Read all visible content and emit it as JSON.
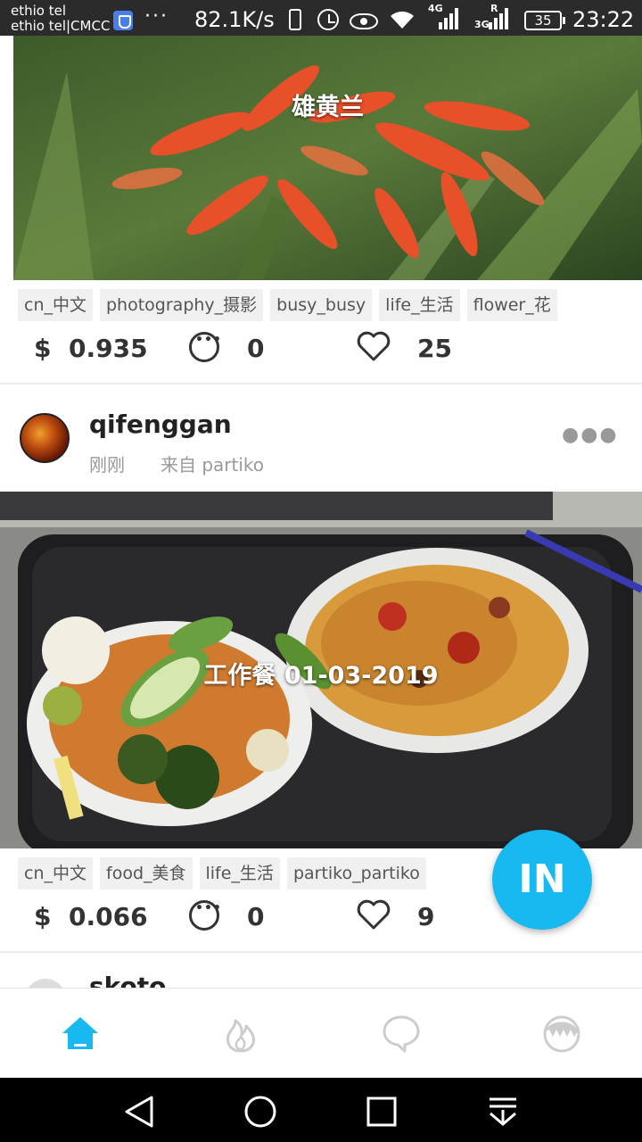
{
  "status_bar": {
    "carrier_1": "ethio tel",
    "carrier_2": "ethio tel|CMCC",
    "dots": "···",
    "net_speed": "82.1K/s",
    "network_1": "4G",
    "network_2": "R",
    "network_3": "3G",
    "battery": "35",
    "time": "23:22"
  },
  "posts": [
    {
      "image_caption": "雄黄兰",
      "tags": [
        "cn_中文",
        "photography_摄影",
        "busy_busy",
        "life_生活",
        "flower_花"
      ],
      "currency": "$",
      "payout": "0.935",
      "comments": "0",
      "likes": "25"
    },
    {
      "author": "qifenggan",
      "time": "刚刚",
      "source": "来自  partiko",
      "image_caption": "工作餐 01-03-2019",
      "tags": [
        "cn_中文",
        "food_美食",
        "life_生活",
        "partiko_partiko"
      ],
      "currency": "$",
      "payout": "0.066",
      "comments": "0",
      "likes": "9"
    }
  ],
  "next_post_author_peek": "skoto",
  "fab_label": "IN",
  "bottom_nav": {
    "items": [
      "home-icon",
      "fire-icon",
      "chat-icon",
      "profile-icon"
    ],
    "active": "home-icon"
  },
  "colors": {
    "accent": "#18b8f0",
    "nav_inactive": "#cccccc"
  }
}
